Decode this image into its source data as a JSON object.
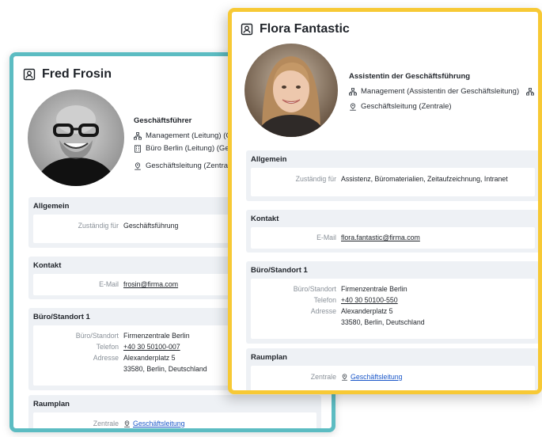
{
  "fred": {
    "name": "Fred Frosin",
    "role": "Geschäftsführer",
    "dept1": "Management (Leitung) (Ge",
    "dept2": "Büro Berlin (Leitung) (Gesc",
    "location": "Geschäftsleitung (Zentrale)",
    "sections": {
      "general": {
        "title": "Allgemein",
        "label": "Zuständig für",
        "value": "Geschäftsführung"
      },
      "contact": {
        "title": "Kontakt",
        "label": "E-Mail",
        "value": "frosin@firma.com"
      },
      "office": {
        "title": "Büro/Standort 1",
        "site_label": "Büro/Standort",
        "site": "Firmenzentrale Berlin",
        "phone_label": "Telefon",
        "phone": "+40 30 50100-007",
        "address_label": "Adresse",
        "address1": "Alexanderplatz 5",
        "address2": "33580, Berlin, Deutschland"
      },
      "room": {
        "title": "Raumplan",
        "label": "Zentrale",
        "value": "Geschäftsleitung"
      }
    }
  },
  "flora": {
    "name": "Flora Fantastic",
    "role": "Assistentin der Geschäftsführung",
    "dept1": "Management (Assistentin der Geschäftsleitung)",
    "location": "Geschäftsleitung (Zentrale)",
    "sections": {
      "general": {
        "title": "Allgemein",
        "label": "Zuständig für",
        "value": "Assistenz, Büromaterialien, Zeitaufzeichnung, Intranet"
      },
      "contact": {
        "title": "Kontakt",
        "label": "E-Mail",
        "value": "flora.fantastic@firma.com"
      },
      "office": {
        "title": "Büro/Standort 1",
        "site_label": "Büro/Standort",
        "site": "Firmenzentrale Berlin",
        "phone_label": "Telefon",
        "phone": "+40 30 50100-550",
        "address_label": "Adresse",
        "address1": "Alexanderplatz 5",
        "address2": "33580, Berlin, Deutschland"
      },
      "room": {
        "title": "Raumplan",
        "label": "Zentrale",
        "value": "Geschäftsleitung"
      }
    }
  },
  "colors": {
    "fred_border": "#5cbcc2",
    "flora_border": "#f7c935",
    "link": "#1a57c9",
    "section_bg": "#eef1f5"
  },
  "icons": {
    "contact_card": "contact-card-icon",
    "org": "org-chart-icon",
    "building": "building-icon",
    "location": "location-person-icon"
  }
}
